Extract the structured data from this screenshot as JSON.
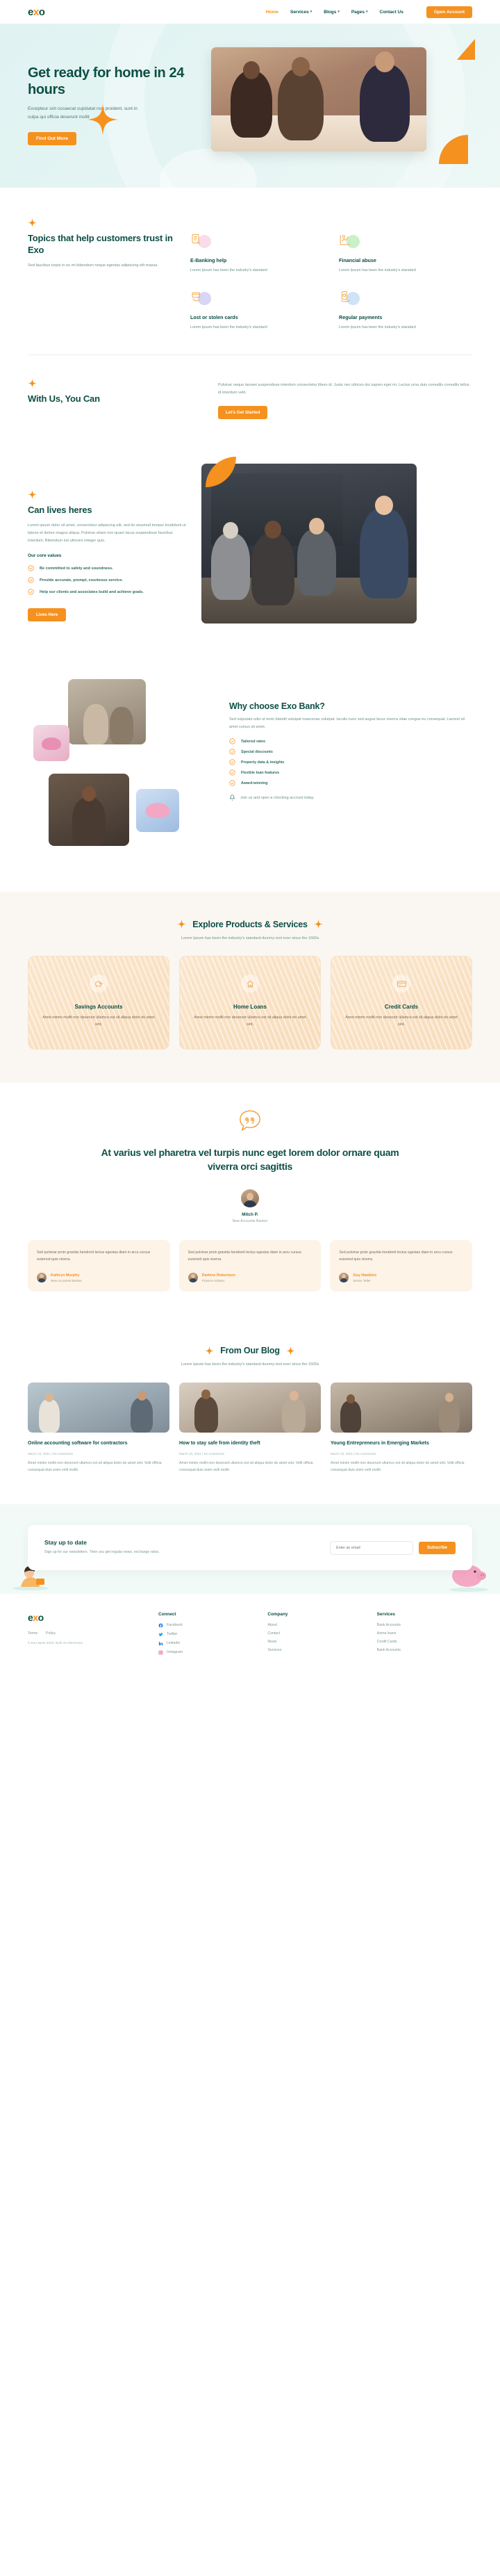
{
  "nav": {
    "logo": "exo",
    "links": [
      {
        "label": "Home",
        "active": true,
        "caret": false
      },
      {
        "label": "Services",
        "active": false,
        "caret": true
      },
      {
        "label": "Blogs",
        "active": false,
        "caret": true
      },
      {
        "label": "Pages",
        "active": false,
        "caret": true
      },
      {
        "label": "Contact Us",
        "active": false,
        "caret": false
      }
    ],
    "cta": "Open Account"
  },
  "hero": {
    "title": "Get ready for home in 24 hours",
    "subtitle": "Excepteur sint occaecat cupidatat non proident, sunt in culpa qui officia deserunt mollit",
    "button": "Find Out More"
  },
  "topics": {
    "title": "Topics that help customers trust in Exo",
    "desc": "Sed faucibus turpis in eu mi bibendum neque egestas adipiscing elit massa.",
    "cards": [
      {
        "title": "E-Banking help",
        "text": "Lorem Ipsum has been the industry's standard",
        "blob": "#f9dcea",
        "icon": "ebanking-icon"
      },
      {
        "title": "Financial abuse",
        "text": "Lorem Ipsum has been the industry's standard",
        "blob": "#c9f0c6",
        "icon": "chart-icon"
      },
      {
        "title": "Lost or stolen cards",
        "text": "Lorem Ipsum has been the industry's standard",
        "blob": "#d9d5f4",
        "icon": "card-hand-icon"
      },
      {
        "title": "Regular payments",
        "text": "Lorem Ipsum has been the industry's standard",
        "blob": "#cfe2f7",
        "icon": "cash-hand-icon"
      }
    ]
  },
  "withus": {
    "title": "With Us, You Can",
    "paragraph": "Pulvinar neque laoreet suspendisse interdum consectetur libero id. Justo nec ultrices dui sapien eget mi. Lectus urna duis convallis convallis tellus id interdum velit.",
    "button": "Let's Get Started"
  },
  "lives": {
    "title": "Can lives heres",
    "paragraph": "Lorem ipsum dolor sit amet, consectetur adipiscing elit, sed do eiusmod tempor incididunt ut labore et dolore magna aliqua. Pulvinar etiam non quam lacus suspendisse faucibus interdum. Bibendum est ultricies integer quis.",
    "values_heading": "Our core values",
    "values": [
      "Be committed to safety and soundness.",
      "Provide accurate, prompt, courteous service.",
      "Help our clients and associates build and achieve goals."
    ],
    "button": "Lives Here"
  },
  "why": {
    "title": "Why choose Exo Bank?",
    "paragraph": "Sed vulputate odio ut enim blandit volutpat maecenas volutpat. Iaculis nunc sed augue lacus viverra vitae congue eu consequat. Laoreet sit amet cursus sit amet.",
    "features": [
      "Tailored rates",
      "Special discounts",
      "Property data & insights",
      "Flexible loan features",
      "Award-winning"
    ],
    "note": "Join us and open a checking account today."
  },
  "products": {
    "title": "Explore Products & Services",
    "subtitle": "Lorem Ipsum has been the industry's standard dummy text ever since the 1500s",
    "cards": [
      {
        "title": "Savings Accounts",
        "text": "Amet minim mollit non deserunt ullamco est sit aliqua dolor do amet sint.",
        "icon": "piggy-bank-icon"
      },
      {
        "title": "Home Loans",
        "text": "Amet minim mollit non deserunt ullamco est sit aliqua dolor do amet sint.",
        "icon": "house-loan-icon"
      },
      {
        "title": "Credit Cards",
        "text": "Amet minim mollit non deserunt ullamco est sit aliqua dolor do amet sint.",
        "icon": "credit-card-icon"
      }
    ]
  },
  "testimonial": {
    "quote": "At varius vel pharetra vel turpis nunc eget lorem dolor ornare quam viverra orci sagittis",
    "author_name": "Mitch P.",
    "author_role": "New Accounts Banker",
    "cards": [
      {
        "text": "Sed pulvinar proin gravida hendrerit lectus egestas diam in arcu cursus euismod quis viverra.",
        "name": "Kathryn Murphy",
        "role": "New Accounts Banker"
      },
      {
        "text": "Sed pulvinar proin gravida hendrerit lectus egestas diam in arcu cursus euismod quis viverra.",
        "name": "Darlene Robertson",
        "role": "Finance Advisor"
      },
      {
        "text": "Sed pulvinar proin gravida hendrerit lectus egestas diam in arcu cursus euismod quis viverra.",
        "name": "Guy Hawkins",
        "role": "Senior Teller"
      }
    ]
  },
  "blog": {
    "title": "From Our Blog",
    "subtitle": "Lorem Ipsum has been the industry's standard dummy text ever since the 1500s",
    "posts": [
      {
        "title": "Online accounting software for contractors",
        "meta": "March 10, 2021 | No Comments",
        "text": "Amet minim mollit non deserunt ullamco est sit aliqua dolor do amet sint. Velit officia consequat duis enim velit mollit."
      },
      {
        "title": "How to stay safe from identity theft",
        "meta": "March 10, 2021 | No Comments",
        "text": "Amet minim mollit non deserunt ullamco est sit aliqua dolor do amet sint. Velit officia consequat duis enim velit mollit."
      },
      {
        "title": "Young Entrepreneurs in Emerging Markets",
        "meta": "March 10, 2021 | No Comments",
        "text": "Amet minim mollit non deserunt ullamco est sit aliqua dolor do amet sint. Velit officia consequat duis enim velit mollit."
      }
    ]
  },
  "newsletter": {
    "title": "Stay up to date",
    "text": "Sign up for our newsletters. Then you get regular news, exchange rates.",
    "placeholder": "Enter an email",
    "button": "Subscribe"
  },
  "footer": {
    "logo": "exo",
    "links": [
      "Terms",
      "Policy"
    ],
    "copyright": "© Exo Bank 2023. Built on Elementor",
    "columns": [
      {
        "heading": "Connect",
        "items": [
          {
            "label": "Facebook",
            "icon": "facebook-icon",
            "color": "#1877f2"
          },
          {
            "label": "Twitter",
            "icon": "twitter-icon",
            "color": "#1da1f2"
          },
          {
            "label": "Linkedin",
            "icon": "linkedin-icon",
            "color": "#0a66c2"
          },
          {
            "label": "Instagram",
            "icon": "instagram-icon",
            "color": "#e1306c"
          }
        ]
      },
      {
        "heading": "Company",
        "items": [
          {
            "label": "About"
          },
          {
            "label": "Contact"
          },
          {
            "label": "News"
          },
          {
            "label": "Services"
          }
        ]
      },
      {
        "heading": "Services",
        "items": [
          {
            "label": "Bank Accounts"
          },
          {
            "label": "Home loans"
          },
          {
            "label": "Credit Cards"
          },
          {
            "label": "Bank Accounts"
          }
        ]
      }
    ]
  },
  "colors": {
    "brand_green": "#0d4f45",
    "accent_orange": "#f5911e",
    "hero_bg": "#e0f3f2",
    "muted_text": "#6d938c"
  }
}
